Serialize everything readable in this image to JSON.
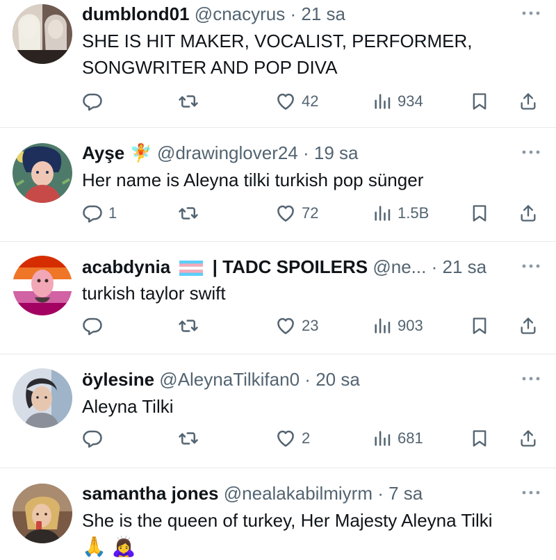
{
  "replies": [
    {
      "name": "dumblond01",
      "handle": "@cnacyrus",
      "time": "21 sa",
      "text_lines": [
        "SHE IS HIT MAKER, VOCALIST, PERFORMER,",
        "SONGWRITER AND POP DIVA"
      ],
      "reply_count": "",
      "like_count": "42",
      "view_count": "934"
    },
    {
      "name": "Ayşe",
      "name_emoji": "🧚",
      "handle": "@drawinglover24",
      "time": "19 sa",
      "text_lines": [
        "Her name is Aleyna tilki turkish pop sünger"
      ],
      "reply_count": "1",
      "like_count": "72",
      "view_count": "1.5B"
    },
    {
      "name": "acabdynia",
      "name_suffix": "| TADC SPOILERS",
      "handle": "@ne...",
      "time": "21 sa",
      "text_lines": [
        "turkish taylor swift"
      ],
      "reply_count": "",
      "like_count": "23",
      "view_count": "903"
    },
    {
      "name": "öylesine",
      "handle": "@AleynaTilkifan0",
      "time": "20 sa",
      "text_lines": [
        "Aleyna Tilki"
      ],
      "reply_count": "",
      "like_count": "2",
      "view_count": "681"
    },
    {
      "name": "samantha jones",
      "handle": "@nealakabilmiyrm",
      "time": "7 sa",
      "text_lines": [
        "She is the queen of turkey, Her Majesty Aleyna Tilki",
        "🙏 🙇‍♀️"
      ],
      "reply_count": "",
      "like_count": "",
      "view_count": ""
    }
  ],
  "separator": "·",
  "colors": {
    "text": "#0f1419",
    "secondary": "#536471",
    "divider": "#e6e9ec"
  },
  "icons": [
    "reply-icon",
    "retweet-icon",
    "like-icon",
    "views-icon",
    "bookmark-icon",
    "share-icon",
    "more-icon"
  ]
}
